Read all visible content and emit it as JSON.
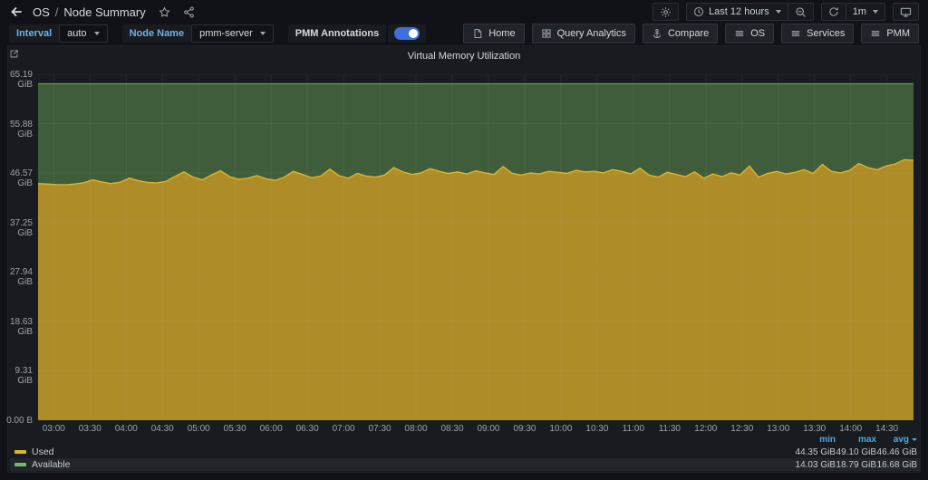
{
  "header": {
    "breadcrumb_section": "OS",
    "breadcrumb_separator": "/",
    "breadcrumb_page": "Node Summary",
    "time_range": "Last 12 hours",
    "refresh_interval": "1m"
  },
  "toolbar": {
    "interval_label": "Interval",
    "interval_value": "auto",
    "node_label": "Node Name",
    "node_value": "pmm-server",
    "annotations_label": "PMM Annotations",
    "annotations_enabled": true,
    "links": [
      "Home",
      "Query Analytics",
      "Compare",
      "OS",
      "Services",
      "PMM"
    ]
  },
  "panel": {
    "title": "Virtual Memory Utilization"
  },
  "chart_data": {
    "type": "area",
    "title": "Virtual Memory Utilization",
    "unit": "GiB",
    "description": "Stacked memory: Used (yellow) plus Available (green) summing to a flat total",
    "y_max": 65.19,
    "y_tick_values": [
      0,
      9.31,
      18.63,
      27.94,
      37.25,
      46.57,
      55.88,
      65.19
    ],
    "y_tick_labels": [
      "0.00 B",
      "9.31 GiB",
      "18.63 GiB",
      "27.94 GiB",
      "37.25 GiB",
      "46.57 GiB",
      "55.88 GiB",
      "65.19 GiB"
    ],
    "x_tick_labels": [
      "03:00",
      "03:30",
      "04:00",
      "04:30",
      "05:00",
      "05:30",
      "06:00",
      "06:30",
      "07:00",
      "07:30",
      "08:00",
      "08:30",
      "09:00",
      "09:30",
      "10:00",
      "10:30",
      "11:00",
      "11:30",
      "12:00",
      "12:30",
      "13:00",
      "13:30",
      "14:00",
      "14:30"
    ],
    "x_range_minutes": [
      167,
      892
    ],
    "total_gib": 63.4,
    "series": [
      {
        "name": "Used",
        "fill": "#ae8c28",
        "line": "#dfb226",
        "values": [
          44.6,
          44.5,
          44.4,
          44.35,
          44.5,
          44.75,
          45.3,
          44.9,
          44.6,
          44.85,
          45.6,
          45.15,
          44.8,
          44.7,
          45.0,
          45.9,
          46.8,
          45.8,
          45.3,
          46.2,
          47.0,
          45.9,
          45.4,
          45.6,
          46.1,
          45.5,
          45.2,
          45.8,
          46.9,
          46.3,
          45.7,
          46.0,
          47.3,
          46.1,
          45.6,
          46.5,
          46.0,
          45.8,
          46.2,
          47.6,
          46.8,
          46.3,
          46.6,
          47.4,
          46.9,
          46.5,
          46.8,
          46.4,
          47.0,
          46.6,
          46.3,
          47.8,
          46.5,
          46.2,
          46.6,
          46.4,
          46.9,
          46.7,
          46.5,
          47.1,
          46.8,
          46.9,
          46.6,
          47.2,
          46.9,
          46.4,
          47.5,
          46.2,
          45.8,
          46.7,
          46.3,
          45.9,
          46.8,
          45.6,
          46.4,
          45.9,
          46.6,
          46.2,
          47.9,
          45.8,
          46.5,
          46.9,
          46.4,
          46.7,
          47.2,
          46.5,
          48.2,
          46.9,
          46.6,
          47.1,
          48.4,
          47.6,
          47.2,
          47.9,
          48.3,
          49.1,
          49.0
        ]
      },
      {
        "name": "Available",
        "fill": "#3f5d3a",
        "line": "#669c50",
        "derived": "total_gib - Used"
      }
    ],
    "legend": {
      "columns": [
        "min",
        "max",
        "avg"
      ],
      "sorted_column": "avg",
      "rows": [
        {
          "name": "Used",
          "color": "#e3b80f",
          "min": "44.35 GiB",
          "max": "49.10 GiB",
          "avg": "46.46 GiB",
          "highlight": false
        },
        {
          "name": "Available",
          "color": "#6bbf69",
          "min": "14.03 GiB",
          "max": "18.79 GiB",
          "avg": "16.68 GiB",
          "highlight": true
        }
      ]
    }
  }
}
